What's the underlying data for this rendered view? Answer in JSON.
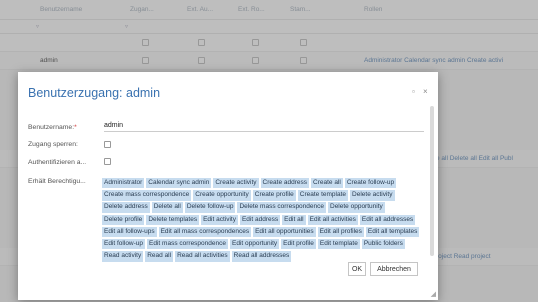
{
  "grid": {
    "columns": [
      "Benutzername",
      "Zugan...",
      "Ext. Au...",
      "Ext. Ro...",
      "Stam...",
      "Rollen"
    ],
    "filter_icon": "filter-icon",
    "admin_row": {
      "username": "admin",
      "roles": "Administrator  Calendar sync admin  Create activi"
    },
    "bg_row_texts": [
      "e all  Delete all  Edit all  Publ",
      "roject  Read project"
    ]
  },
  "dialog": {
    "title": "Benutzerzugang: admin",
    "maximize_icon": "maximize-icon",
    "close_icon": "close-icon",
    "fields": {
      "username_label": "Benutzername:",
      "required_mark": "*",
      "username_value": "admin",
      "locked_label": "Zugang sperren:",
      "authenticate_label": "Authentifizieren a...",
      "permissions_label": "Erhält Berechtigu..."
    },
    "permissions": [
      "Administrator",
      "Calendar sync admin",
      "Create activity",
      "Create address",
      "Create all",
      "Create follow-up",
      "Create mass correspondence",
      "Create opportunity",
      "Create profile",
      "Create template",
      "Delete activity",
      "Delete address",
      "Delete all",
      "Delete follow-up",
      "Delete mass correspondence",
      "Delete opportunity",
      "Delete profile",
      "Delete templates",
      "Edit activity",
      "Edit address",
      "Edit all",
      "Edit all activities",
      "Edit all addresses",
      "Edit all follow-ups",
      "Edit all mass correspondences",
      "Edit all opportunities",
      "Edit all profiles",
      "Edit all templates",
      "Edit follow-up",
      "Edit mass correspondence",
      "Edit opportunity",
      "Edit profile",
      "Edit template",
      "Public folders",
      "Read activity",
      "Read all",
      "Read all activities",
      "Read all addresses"
    ],
    "ok_label": "OK",
    "cancel_label": "Abbrechen"
  },
  "colors": {
    "title": "#3a72b0",
    "tag_bg": "#c7dcef",
    "overlay": "rgba(110,110,110,0.45)"
  }
}
